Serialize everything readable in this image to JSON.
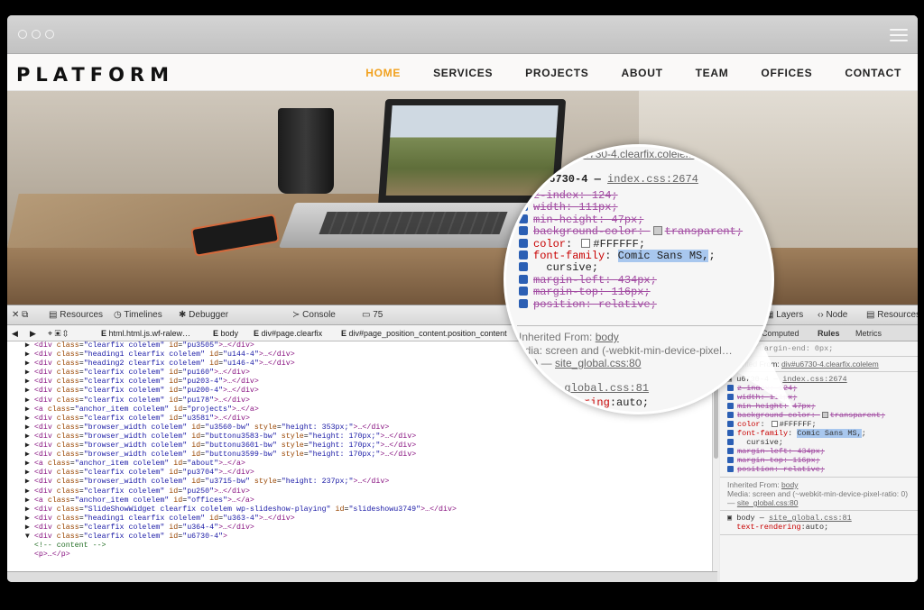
{
  "browser": {
    "menu_icon": "hamburger-icon"
  },
  "site": {
    "logo": "PLATFORM",
    "menu": [
      "HOME",
      "SERVICES",
      "PROJECTS",
      "ABOUT",
      "TEAM",
      "OFFICES",
      "CONTACT"
    ],
    "active": "HOME",
    "accent": "#f1a11e"
  },
  "devtools": {
    "toolbar": {
      "resources": "Resources",
      "timelines": "Timelines",
      "debugger": "Debugger",
      "console": "Console",
      "count": "75",
      "layers": "Layers",
      "node": "Node",
      "resources2": "Resources"
    },
    "breadcrumbs": [
      "html.html.js.wf-ralew…",
      "body",
      "div#page.clearfix",
      "div#page_position_content.position_content"
    ],
    "code_lines": [
      {
        "indent": "    ",
        "tag": "div",
        "cls": "clearfix colelem",
        "id": "pu3505",
        "style": ""
      },
      {
        "indent": "    ",
        "tag": "div",
        "cls": "heading1 clearfix colelem",
        "id": "u144-4",
        "style": ""
      },
      {
        "indent": "    ",
        "tag": "div",
        "cls": "heading2 clearfix colelem",
        "id": "u146-4",
        "style": ""
      },
      {
        "indent": "    ",
        "tag": "div",
        "cls": "clearfix colelem",
        "id": "pu160",
        "style": ""
      },
      {
        "indent": "    ",
        "tag": "div",
        "cls": "clearfix colelem",
        "id": "pu203-4",
        "style": ""
      },
      {
        "indent": "    ",
        "tag": "div",
        "cls": "clearfix colelem",
        "id": "pu200-4",
        "style": ""
      },
      {
        "indent": "    ",
        "tag": "div",
        "cls": "clearfix colelem",
        "id": "pu178",
        "style": ""
      },
      {
        "indent": "    ",
        "tag": "a",
        "cls": "anchor_item colelem",
        "id": "projects",
        "style": ""
      },
      {
        "indent": "    ",
        "tag": "div",
        "cls": "clearfix colelem",
        "id": "u3581",
        "style": ""
      },
      {
        "indent": "    ",
        "tag": "div",
        "cls": "browser_width colelem",
        "id": "u3560-bw",
        "style": "height: 353px;"
      },
      {
        "indent": "    ",
        "tag": "div",
        "cls": "browser_width colelem",
        "id": "buttonu3583-bw",
        "style": "height: 170px;"
      },
      {
        "indent": "    ",
        "tag": "div",
        "cls": "browser_width colelem",
        "id": "buttonu3601-bw",
        "style": "height: 170px;"
      },
      {
        "indent": "    ",
        "tag": "div",
        "cls": "browser_width colelem",
        "id": "buttonu3599-bw",
        "style": "height: 170px;"
      },
      {
        "indent": "    ",
        "tag": "a",
        "cls": "anchor_item colelem",
        "id": "about",
        "style": ""
      },
      {
        "indent": "    ",
        "tag": "div",
        "cls": "clearfix colelem",
        "id": "pu3704",
        "style": ""
      },
      {
        "indent": "    ",
        "tag": "div",
        "cls": "browser_width colelem",
        "id": "u3715-bw",
        "style": "height: 237px;"
      },
      {
        "indent": "    ",
        "tag": "div",
        "cls": "clearfix colelem",
        "id": "pu250",
        "style": ""
      },
      {
        "indent": "    ",
        "tag": "a",
        "cls": "anchor_item colelem",
        "id": "offices",
        "style": ""
      },
      {
        "indent": "    ",
        "tag": "div",
        "cls": "SlideShowWidget clearfix colelem wp-slideshow-playing",
        "id": "slideshowu3749",
        "style": ""
      },
      {
        "indent": "    ",
        "tag": "div",
        "cls": "heading1 clearfix colelem",
        "id": "u363-4",
        "style": ""
      },
      {
        "indent": "    ",
        "tag": "div",
        "cls": "clearfix colelem",
        "id": "u364-4",
        "style": ""
      },
      {
        "indent": "    ",
        "tag": "div",
        "cls": "clearfix colelem",
        "id": "u6730-4",
        "style": ""
      }
    ],
    "comment": "<!-- content -->",
    "last_line": "<p>…</p>",
    "panel_tabs": [
      "Computed",
      "Rules",
      "Metrics"
    ],
    "active_panel_tab": "Rules",
    "media_partial": "edia: screen and (-webkit-min-device-pixel…",
    "rules": {
      "header_top": "div#u6730-4.clearfix.colelem",
      "selector": "u6730-4",
      "source": "index.css:2674",
      "props": [
        {
          "name": "z-index",
          "value": "124",
          "struck": true
        },
        {
          "name": "width",
          "value": "111px",
          "struck": true
        },
        {
          "name": "min-height",
          "value": "47px",
          "struck": true
        },
        {
          "name": "background-color",
          "value": "transparent",
          "struck": true,
          "swatch": "#cccccc"
        },
        {
          "name": "color",
          "value": "#FFFFFF",
          "struck": false,
          "swatch": "#FFFFFF"
        },
        {
          "name": "font-family",
          "value": "Comic Sans MS,",
          "struck": false,
          "selected": true
        },
        {
          "name": "",
          "value": "cursive",
          "struck": false
        },
        {
          "name": "margin-left",
          "value": "434px",
          "struck": true
        },
        {
          "name": "margin-top",
          "value": "116px",
          "struck": true
        },
        {
          "name": "position",
          "value": "relative",
          "struck": true
        }
      ],
      "inherited_label": "Inherited From:",
      "inherited_link": "body",
      "media": "Media: screen and (~webkit-min-device-pixel-ratio: 0) —",
      "media_link": "site_global.css:80",
      "body_rule": "body",
      "body_source": "site_global.css:81",
      "body_prop": "text-rendering",
      "body_val": "auto",
      "inherited_top": "Inherited From:",
      "inherited_top_link": "div#u6730-4.clearfix.colelem",
      "prev_rule": "webkit-margin-end: 0px;"
    }
  }
}
